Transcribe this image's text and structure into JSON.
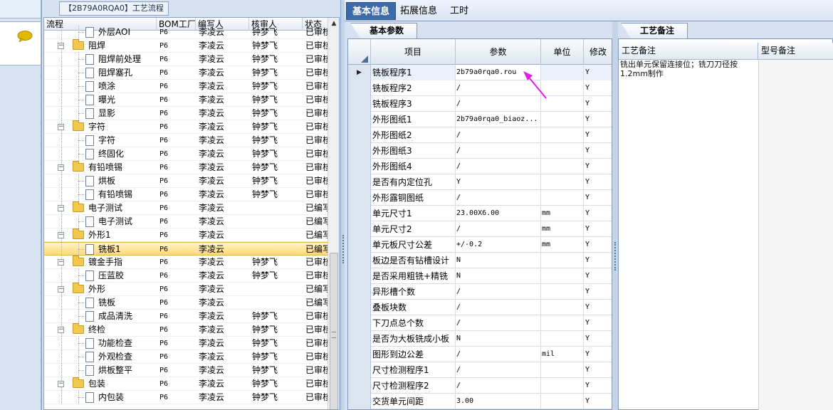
{
  "colors": {
    "accent_tab": "#3d6aa8",
    "selection": "#ffd978",
    "annotation_arrow": "#e21de4",
    "folder": "#f2c94c"
  },
  "left_strip": {
    "icon": "speech-bubble-icon"
  },
  "tree_panel": {
    "title": "【2B79A0RQA0】工艺流程",
    "columns": [
      "流程",
      "BOM工厂",
      "编写人",
      "核审人",
      "状态"
    ],
    "rows": [
      {
        "label": "外层AOI",
        "bom": "P6",
        "editor": "李凌云",
        "reviewer": "钟梦飞",
        "status": "已审核",
        "type": "leaf"
      },
      {
        "label": "阻焊",
        "bom": "P6",
        "editor": "李凌云",
        "reviewer": "钟梦飞",
        "status": "已审核",
        "type": "folder"
      },
      {
        "label": "阻焊前处理",
        "bom": "P6",
        "editor": "李凌云",
        "reviewer": "钟梦飞",
        "status": "已审核",
        "type": "leaf"
      },
      {
        "label": "阻焊塞孔",
        "bom": "P6",
        "editor": "李凌云",
        "reviewer": "钟梦飞",
        "status": "已审核",
        "type": "leaf"
      },
      {
        "label": "喷涂",
        "bom": "P6",
        "editor": "李凌云",
        "reviewer": "钟梦飞",
        "status": "已审核",
        "type": "leaf"
      },
      {
        "label": "曝光",
        "bom": "P6",
        "editor": "李凌云",
        "reviewer": "钟梦飞",
        "status": "已审核",
        "type": "leaf"
      },
      {
        "label": "显影",
        "bom": "P6",
        "editor": "李凌云",
        "reviewer": "钟梦飞",
        "status": "已审核",
        "type": "leaf"
      },
      {
        "label": "字符",
        "bom": "P6",
        "editor": "李凌云",
        "reviewer": "钟梦飞",
        "status": "已审核",
        "type": "folder"
      },
      {
        "label": "字符",
        "bom": "P6",
        "editor": "李凌云",
        "reviewer": "钟梦飞",
        "status": "已审核",
        "type": "leaf"
      },
      {
        "label": "终固化",
        "bom": "P6",
        "editor": "李凌云",
        "reviewer": "钟梦飞",
        "status": "已审核",
        "type": "leaf"
      },
      {
        "label": "有铅喷锡",
        "bom": "P6",
        "editor": "李凌云",
        "reviewer": "钟梦飞",
        "status": "已审核",
        "type": "folder"
      },
      {
        "label": "烘板",
        "bom": "P6",
        "editor": "李凌云",
        "reviewer": "钟梦飞",
        "status": "已审核",
        "type": "leaf"
      },
      {
        "label": "有铅喷锡",
        "bom": "P6",
        "editor": "李凌云",
        "reviewer": "钟梦飞",
        "status": "已审核",
        "type": "leaf"
      },
      {
        "label": "电子测试",
        "bom": "P6",
        "editor": "李凌云",
        "reviewer": "",
        "status": "已编写",
        "type": "folder"
      },
      {
        "label": "电子测试",
        "bom": "P6",
        "editor": "李凌云",
        "reviewer": "",
        "status": "已编写",
        "type": "leaf"
      },
      {
        "label": "外形1",
        "bom": "P6",
        "editor": "李凌云",
        "reviewer": "",
        "status": "已编写",
        "type": "folder"
      },
      {
        "label": "铣板1",
        "bom": "P6",
        "editor": "李凌云",
        "reviewer": "",
        "status": "已编写",
        "type": "leaf",
        "selected": true
      },
      {
        "label": "镀金手指",
        "bom": "P6",
        "editor": "李凌云",
        "reviewer": "钟梦飞",
        "status": "已审核",
        "type": "folder"
      },
      {
        "label": "压蓝胶",
        "bom": "P6",
        "editor": "李凌云",
        "reviewer": "钟梦飞",
        "status": "已审核",
        "type": "leaf"
      },
      {
        "label": "外形",
        "bom": "P6",
        "editor": "李凌云",
        "reviewer": "",
        "status": "已编写",
        "type": "folder"
      },
      {
        "label": "铣板",
        "bom": "P6",
        "editor": "李凌云",
        "reviewer": "",
        "status": "已编写",
        "type": "leaf"
      },
      {
        "label": "成品清洗",
        "bom": "P6",
        "editor": "李凌云",
        "reviewer": "钟梦飞",
        "status": "已审核",
        "type": "leaf"
      },
      {
        "label": "终检",
        "bom": "P6",
        "editor": "李凌云",
        "reviewer": "钟梦飞",
        "status": "已审核",
        "type": "folder"
      },
      {
        "label": "功能检查",
        "bom": "P6",
        "editor": "李凌云",
        "reviewer": "钟梦飞",
        "status": "已审核",
        "type": "leaf"
      },
      {
        "label": "外观检查",
        "bom": "P6",
        "editor": "李凌云",
        "reviewer": "钟梦飞",
        "status": "已审核",
        "type": "leaf"
      },
      {
        "label": "烘板整平",
        "bom": "P6",
        "editor": "李凌云",
        "reviewer": "钟梦飞",
        "status": "已审核",
        "type": "leaf"
      },
      {
        "label": "包装",
        "bom": "P6",
        "editor": "李凌云",
        "reviewer": "钟梦飞",
        "status": "已审核",
        "type": "folder"
      },
      {
        "label": "内包装",
        "bom": "P6",
        "editor": "李凌云",
        "reviewer": "钟梦飞",
        "status": "已审核",
        "type": "leaf"
      }
    ]
  },
  "main_tabs": [
    "基本信息",
    "拓展信息",
    "工时"
  ],
  "param_panel": {
    "tab": "基本参数",
    "columns": [
      "项目",
      "参数",
      "单位",
      "修改"
    ],
    "rows": [
      {
        "item": "铣板程序1",
        "value": "2b79a0rqa0.rou",
        "unit": "",
        "mod": "Y"
      },
      {
        "item": "铣板程序2",
        "value": "/",
        "unit": "",
        "mod": "Y"
      },
      {
        "item": "铣板程序3",
        "value": "/",
        "unit": "",
        "mod": "Y"
      },
      {
        "item": "外形图纸1",
        "value": "2b79a0rqa0_biaoz...",
        "unit": "",
        "mod": "Y"
      },
      {
        "item": "外形图纸2",
        "value": "/",
        "unit": "",
        "mod": "Y"
      },
      {
        "item": "外形图纸3",
        "value": "/",
        "unit": "",
        "mod": "Y"
      },
      {
        "item": "外形图纸4",
        "value": "/",
        "unit": "",
        "mod": "Y"
      },
      {
        "item": "是否有内定位孔",
        "value": "Y",
        "unit": "",
        "mod": "Y"
      },
      {
        "item": "外形露铜图纸",
        "value": "/",
        "unit": "",
        "mod": "Y"
      },
      {
        "item": "单元尺寸1",
        "value": "23.00X6.00",
        "unit": "mm",
        "mod": "Y"
      },
      {
        "item": "单元尺寸2",
        "value": "/",
        "unit": "mm",
        "mod": "Y"
      },
      {
        "item": "单元板尺寸公差",
        "value": "+/-0.2",
        "unit": "mm",
        "mod": "Y"
      },
      {
        "item": "板边是否有钻槽设计",
        "value": "N",
        "unit": "",
        "mod": "Y"
      },
      {
        "item": "是否采用粗铣+精铣",
        "value": "N",
        "unit": "",
        "mod": "Y"
      },
      {
        "item": "异形槽个数",
        "value": "/",
        "unit": "",
        "mod": "Y"
      },
      {
        "item": "叠板块数",
        "value": "/",
        "unit": "",
        "mod": "Y"
      },
      {
        "item": "下刀点总个数",
        "value": "/",
        "unit": "",
        "mod": "Y"
      },
      {
        "item": "是否为大板铣成小板",
        "value": "N",
        "unit": "",
        "mod": "Y"
      },
      {
        "item": "图形到边公差",
        "value": "/",
        "unit": "mil",
        "mod": "Y"
      },
      {
        "item": "尺寸检测程序1",
        "value": "/",
        "unit": "",
        "mod": "Y"
      },
      {
        "item": "尺寸检测程序2",
        "value": "/",
        "unit": "",
        "mod": "Y"
      },
      {
        "item": "交货单元间距",
        "value": "3.00",
        "unit": "",
        "mod": "Y"
      }
    ]
  },
  "notes_panel": {
    "tab": "工艺备注",
    "columns": [
      "工艺备注",
      "型号备注"
    ],
    "process_note": "铣出单元保留连接位；铣刀刀径按1.2mm制作"
  }
}
